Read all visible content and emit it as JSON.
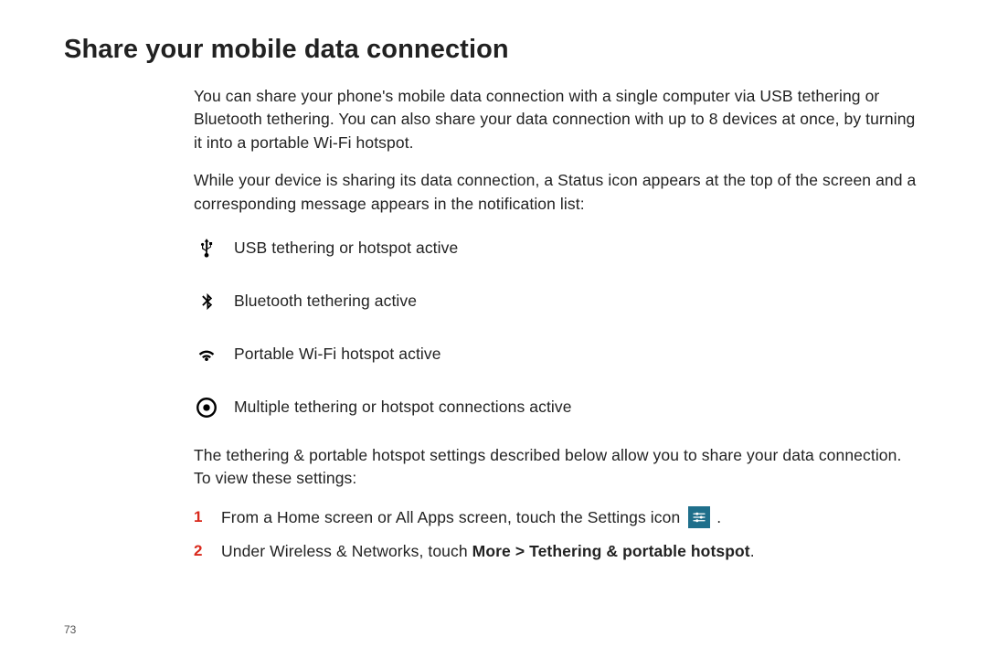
{
  "page_number": "73",
  "title": "Share your mobile data connection",
  "intro_paragraphs": [
    "You can share your phone's mobile data connection with a single computer via USB tethering or Bluetooth tethering. You can also share your data connection with up to 8 devices at once, by turning it into a portable Wi-Fi hotspot.",
    "While your device is sharing its data connection, a Status icon appears at the top of the screen and a corresponding message appears in the notification list:"
  ],
  "status_icons": [
    {
      "icon": "usb",
      "label": "USB tethering or hotspot active"
    },
    {
      "icon": "bluetooth",
      "label": "Bluetooth tethering active"
    },
    {
      "icon": "wifi",
      "label": "Portable Wi-Fi hotspot active"
    },
    {
      "icon": "target",
      "label": "Multiple tethering or hotspot connections active"
    }
  ],
  "post_icons_paragraph": "The tethering & portable hotspot settings described below allow you to share your data connection. To view these settings:",
  "steps": [
    {
      "pre": "From a Home screen or All Apps screen, touch the Settings icon ",
      "has_inline_settings_icon": true,
      "post": " .",
      "bold": ""
    },
    {
      "pre": "Under Wireless & Networks, touch ",
      "has_inline_settings_icon": false,
      "post": ".",
      "bold": "More > Tethering & portable hotspot"
    }
  ]
}
